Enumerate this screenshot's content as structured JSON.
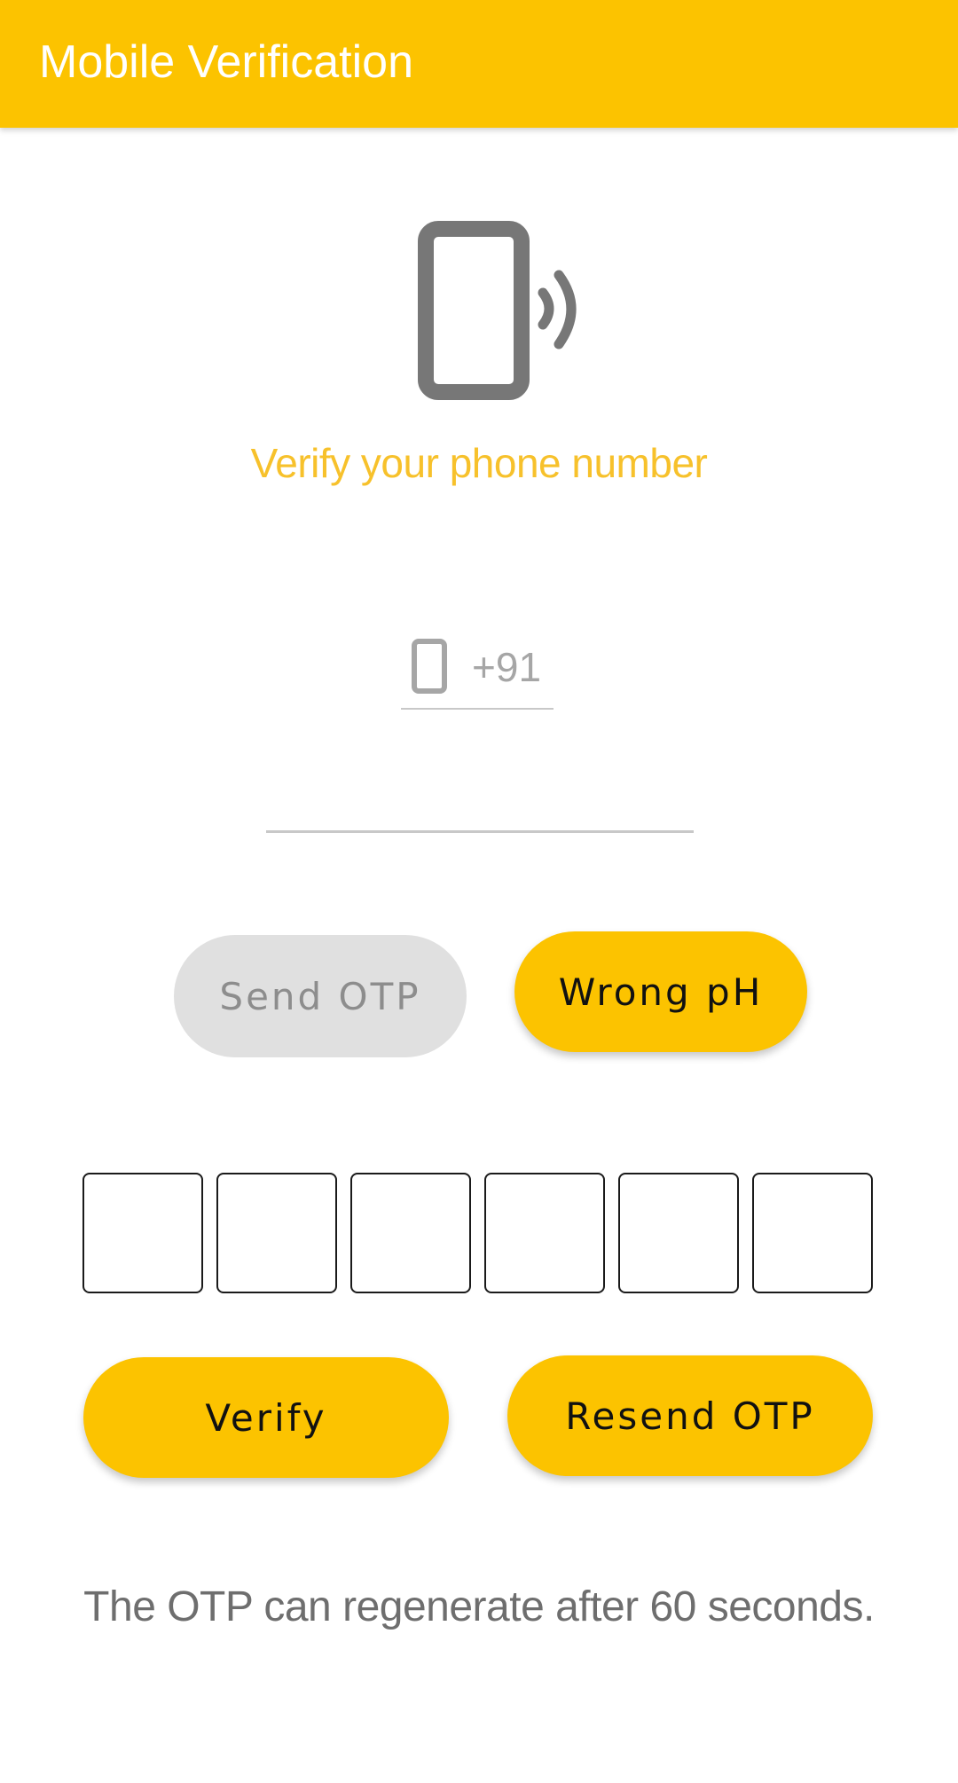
{
  "app_bar": {
    "title": "Mobile Verification"
  },
  "hero": {
    "icon": "phone-ringing-icon",
    "heading": "Verify your phone number"
  },
  "phone_form": {
    "country_icon": "smartphone-icon",
    "country_code": "+91",
    "phone_number": ""
  },
  "actions_top": {
    "send_otp_label": "Send OTP",
    "wrong_ph_label": "Wrong pH"
  },
  "otp": {
    "digits": [
      "",
      "",
      "",
      "",
      "",
      ""
    ]
  },
  "actions_bottom": {
    "verify_label": "Verify",
    "resend_label": "Resend OTP"
  },
  "footer": {
    "note": "The OTP can regenerate after 60 seconds."
  },
  "colors": {
    "accent": "#FCC300",
    "heading": "#F7C12B",
    "disabled_bg": "#E0E0E0",
    "icon_gray": "#777777"
  }
}
